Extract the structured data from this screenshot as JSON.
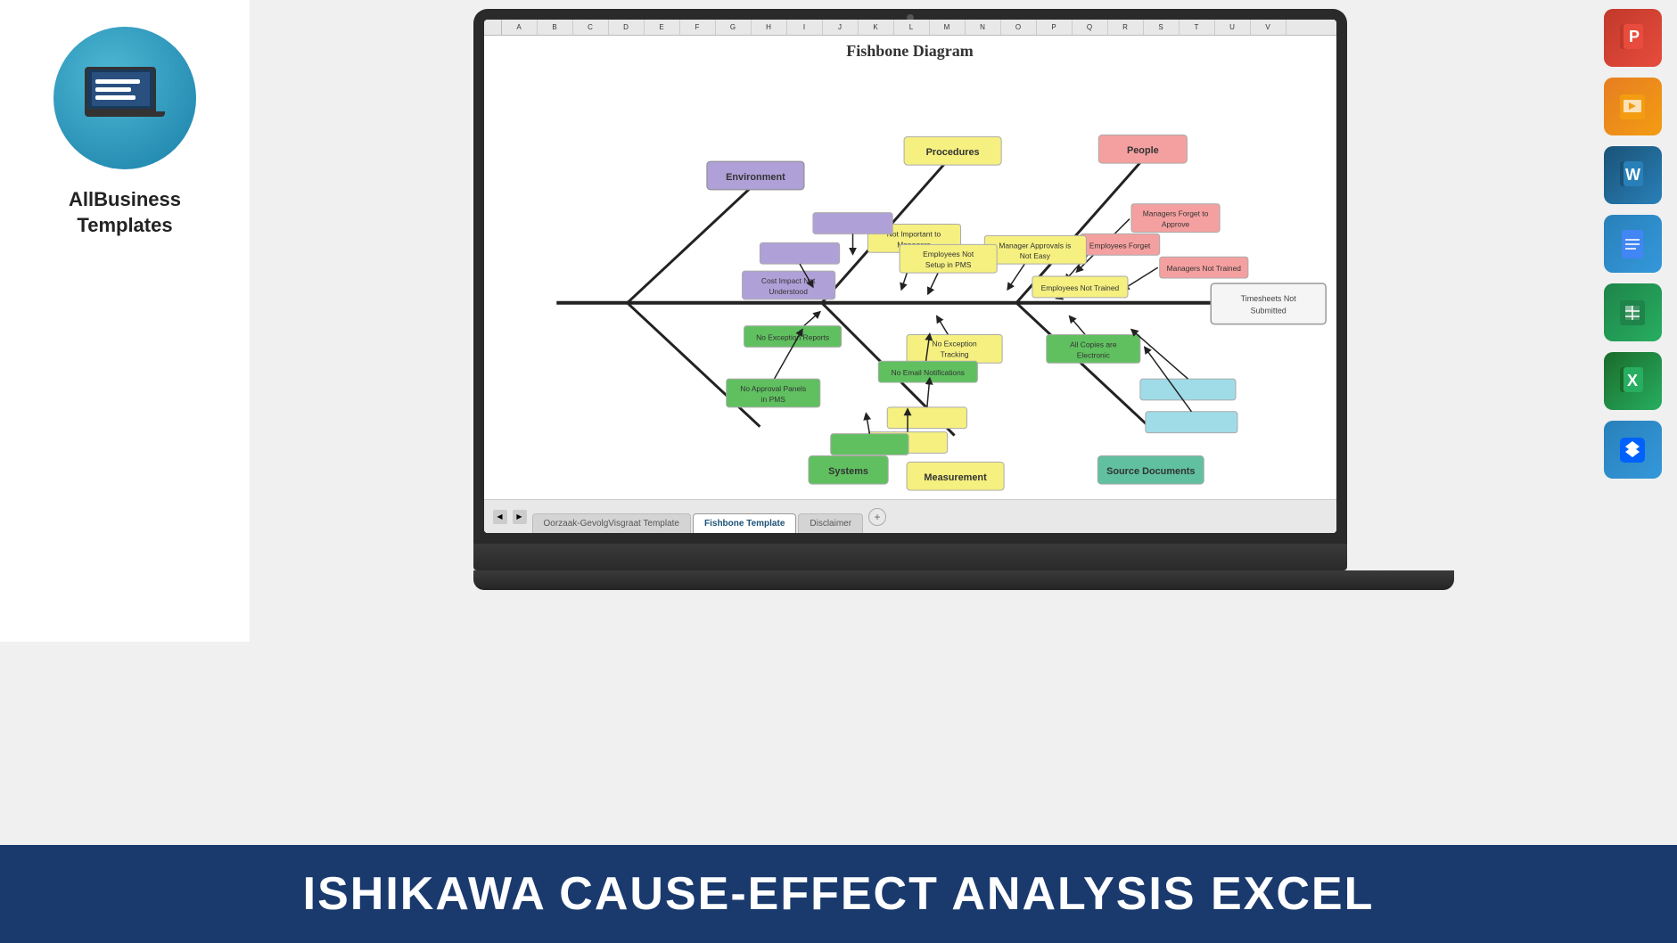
{
  "brand": {
    "name_line1": "AllBusiness",
    "name_line2": "Templates"
  },
  "diagram": {
    "title": "Fishbone Diagram",
    "categories": {
      "environment": "Environment",
      "procedures": "Procedures",
      "people": "People",
      "systems": "Systems",
      "measurement": "Measurement",
      "source_documents": "Source Documents"
    },
    "causes": {
      "managers_forget": "Managers Forget to Approve",
      "employees_forget": "Employees Forget",
      "managers_not_trained": "Managers Not Trained",
      "manager_approvals": "Manager Approvals is Not Easy",
      "not_important": "Not Important to Managers",
      "employees_not_setup": "Employees Not Setup in PMS",
      "employees_not_trained": "Employees Not Trained",
      "cost_impact": "Cost Impact Not Understood",
      "no_exception_reports": "No Exception Reports",
      "no_exception_tracking": "No Exception Tracking",
      "no_email_notifications": "No Email Notifications",
      "all_copies_electronic": "All Copies are Electronic",
      "no_approval_panels": "No Approval Panels in PMS",
      "timesheets_not_submitted": "Timesheets Not Submitted"
    }
  },
  "tabs": {
    "tab1_label": "Oorzaak-GevolgVisgraat Template",
    "tab2_label": "Fishbone Template",
    "tab3_label": "Disclaimer",
    "active_tab": "Fishbone Template"
  },
  "banner": {
    "text": "ISHIKAWA CAUSE-EFFECT ANALYSIS  EXCEL"
  },
  "app_icons": {
    "powerpoint": "P",
    "slides": "▶",
    "word": "W",
    "docs": "≡",
    "sheets": "⊞",
    "excel": "X",
    "dropbox": "❖"
  },
  "colors": {
    "environment_box": "#b0a0d8",
    "procedures_box": "#f5f080",
    "people_box": "#f5a0a0",
    "systems_box": "#60c060",
    "measurement_box": "#f5f080",
    "source_docs_box": "#60c0a0",
    "accent_blue": "#1a3a6e",
    "logo_bg": "#1a9ac0"
  }
}
